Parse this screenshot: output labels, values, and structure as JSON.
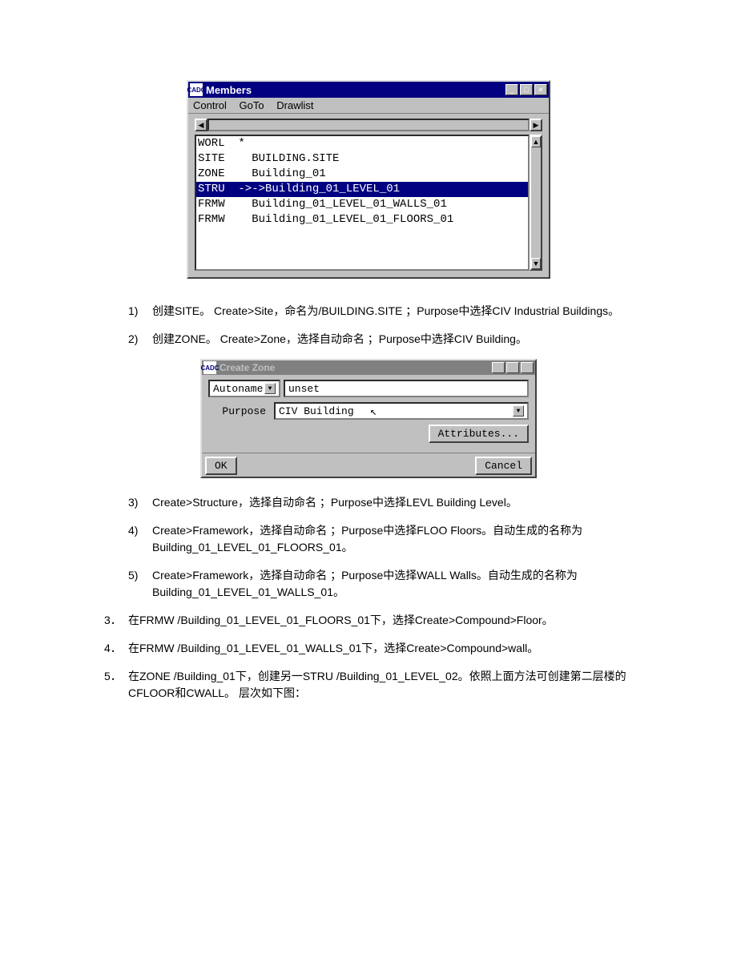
{
  "members_window": {
    "title": "Members",
    "icon_text": "CADC",
    "menus": [
      "Control",
      "GoTo",
      "Drawlist"
    ],
    "rows": [
      {
        "type": "WORL",
        "name": "*",
        "selected": false
      },
      {
        "type": "SITE",
        "name": "BUILDING.SITE",
        "selected": false
      },
      {
        "type": "ZONE",
        "name": "Building_01",
        "selected": false
      },
      {
        "type": "STRU",
        "name": "->Building_01_LEVEL_01",
        "selected": true
      },
      {
        "type": "FRMW",
        "name": "Building_01_LEVEL_01_WALLS_01",
        "selected": false
      },
      {
        "type": "FRMW",
        "name": "Building_01_LEVEL_01_FLOORS_01",
        "selected": false
      }
    ]
  },
  "sub_steps": [
    {
      "n": "1)",
      "t": "创建SITE。 Create>Site，命名为/BUILDING.SITE ；Purpose中选择CIV Industrial Buildings。"
    },
    {
      "n": "2)",
      "t": "创建ZONE。 Create>Zone，选择自动命名 ；Purpose中选择CIV Building。"
    }
  ],
  "zone_window": {
    "title": "Create Zone",
    "icon_text": "CADC",
    "autoname_label": "Autoname",
    "name_value": "unset",
    "purpose_label": "Purpose",
    "purpose_value": "CIV  Building",
    "attributes_btn": "Attributes...",
    "ok_btn": "OK",
    "cancel_btn": "Cancel"
  },
  "sub_steps2": [
    {
      "n": "3)",
      "t": "Create>Structure，选择自动命名 ；Purpose中选择LEVL Building Level。"
    },
    {
      "n": "4)",
      "t": "Create>Framework，选择自动命名 ；Purpose中选择FLOO Floors。自动生成的名称为Building_01_LEVEL_01_FLOORS_01。"
    },
    {
      "n": "5)",
      "t": "Create>Framework，选择自动命名 ；Purpose中选择WALL Walls。自动生成的名称为Building_01_LEVEL_01_WALLS_01。"
    }
  ],
  "main_steps": [
    {
      "n": "3．",
      "t": "在FRMW /Building_01_LEVEL_01_FLOORS_01下，选择Create>Compound>Floor。"
    },
    {
      "n": "4．",
      "t": "在FRMW /Building_01_LEVEL_01_WALLS_01下，选择Create>Compound>wall。"
    },
    {
      "n": "5．",
      "t": "在ZONE /Building_01下，创建另一STRU /Building_01_LEVEL_02。依照上面方法可创建第二层楼的CFLOOR和CWALL。 层次如下图："
    }
  ]
}
